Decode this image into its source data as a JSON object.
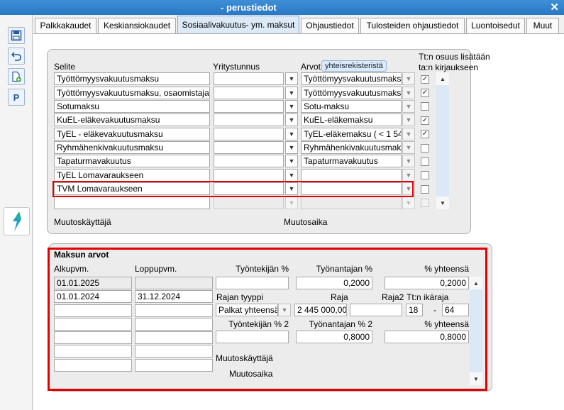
{
  "window": {
    "title": "- perustiedot"
  },
  "toolbar": {
    "p_label": "P"
  },
  "tabs": [
    {
      "label": "Palkkakaudet"
    },
    {
      "label": "Keskiansiokaudet"
    },
    {
      "label": "Sosiaalivakuutus- ym. maksut"
    },
    {
      "label": "Ohjaustiedot"
    },
    {
      "label": "Tulosteiden ohjaustiedot"
    },
    {
      "label": "Luontoisedut"
    },
    {
      "label": "Muut"
    }
  ],
  "top_panel": {
    "headers": {
      "selite": "Selite",
      "yritystunnus": "Yritystunnus",
      "arvot": "Arvot",
      "arvot_button": "yhteisrekisteristä",
      "ttn_line1": "Tt:n osuus lisätään",
      "ttn_line2": "ta:n kirjaukseen"
    },
    "rows": [
      {
        "selite": "Työttömyysvakuutusmaksu",
        "yritystunnus": "",
        "arvot": "Työttömyysvakuutusmaksu",
        "checked": "✓"
      },
      {
        "selite": "Työttömyysvakuutusmaksu, osaomistajat",
        "yritystunnus": "",
        "arvot": "Työttömyysvakuutusmaksu",
        "checked": "✓"
      },
      {
        "selite": "Sotumaksu",
        "yritystunnus": "",
        "arvot": "Sotu-maksu",
        "checked": ""
      },
      {
        "selite": "KuEL-eläkevakuutusmaksu",
        "yritystunnus": "",
        "arvot": "KuEL-eläkemaksu",
        "checked": "✓"
      },
      {
        "selite": "TyEL - eläkevakuutusmaksu",
        "yritystunnus": "",
        "arvot": "TyEL-eläkemaksu ( < 1 542",
        "checked": "✓"
      },
      {
        "selite": "Ryhmähenkivakuutusmaksu",
        "yritystunnus": "",
        "arvot": "Ryhmähenkivakuutusmaks",
        "checked": ""
      },
      {
        "selite": "Tapaturmavakuutus",
        "yritystunnus": "",
        "arvot": "Tapaturmavakuutus",
        "checked": ""
      },
      {
        "selite": "TyEL Lomavaraukseen",
        "yritystunnus": "",
        "arvot": "",
        "checked": ""
      },
      {
        "selite": "TVM Lomavaraukseen",
        "yritystunnus": "",
        "arvot": "",
        "checked": ""
      },
      {
        "selite": "",
        "yritystunnus": "",
        "arvot": "",
        "checked": ""
      }
    ],
    "muutoskayttaja": "Muutoskäyttäjä",
    "muutosaika": "Muutosaika"
  },
  "bottom_panel": {
    "title": "Maksun arvot",
    "alkupvm": "Alkupvm.",
    "loppupvm": "Loppupvm.",
    "dates": [
      {
        "alku": "01.01.2025",
        "loppu": ""
      },
      {
        "alku": "01.01.2024",
        "loppu": "31.12.2024"
      },
      {
        "alku": "",
        "loppu": ""
      },
      {
        "alku": "",
        "loppu": ""
      },
      {
        "alku": "",
        "loppu": ""
      },
      {
        "alku": "",
        "loppu": ""
      },
      {
        "alku": "",
        "loppu": ""
      }
    ],
    "tyontekijan": "Työntekijän %",
    "tyonantajan": "Työnantajan %",
    "yhteensa": "% yhteensä",
    "tyontekijan_val": "",
    "tyonantajan_val": "0,2000",
    "yhteensa_val": "0,2000",
    "rajan_tyyppi": "Rajan tyyppi",
    "raja": "Raja",
    "raja2": "Raja2",
    "ttn_ikaraja": "Tt:n ikäraja",
    "rajan_tyyppi_val": "Palkat yhteensä",
    "raja_val": "2 445 000,00",
    "raja2_val": "",
    "ika_from": "18",
    "ika_dash": "-",
    "ika_to": "64",
    "tyontekijan2": "Työntekijän % 2",
    "tyonantajan2": "Työnantajan % 2",
    "yhteensa2": "% yhteensä",
    "tyontekijan2_val": "",
    "tyonantajan2_val": "0,8000",
    "yhteensa2_val": "0,8000",
    "muutoskayttaja": "Muutoskäyttäjä",
    "muutosaika": "Muutosaika"
  }
}
